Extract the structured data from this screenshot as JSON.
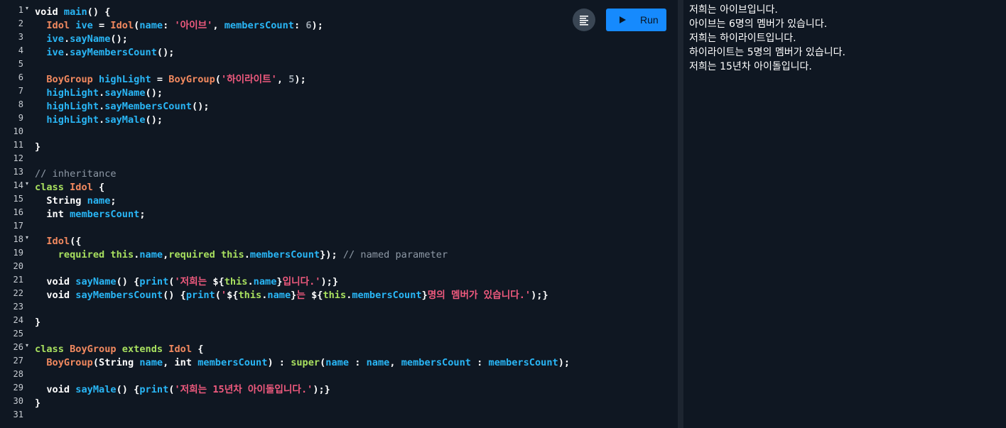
{
  "toolbar": {
    "format_icon": "format-align-icon",
    "run_icon": "play-icon",
    "run_label": "Run"
  },
  "editor": {
    "fold_glyph": "▾",
    "lines": [
      {
        "n": "1",
        "fold": true,
        "tokens": [
          [
            "kw",
            "void "
          ],
          [
            "fn",
            "main"
          ],
          [
            "pun",
            "() {"
          ]
        ]
      },
      {
        "n": "2",
        "fold": false,
        "tokens": [
          [
            "pun",
            "  "
          ],
          [
            "cls",
            "Idol "
          ],
          [
            "id",
            "ive"
          ],
          [
            "pun",
            " = "
          ],
          [
            "cls",
            "Idol"
          ],
          [
            "pun",
            "("
          ],
          [
            "id",
            "name"
          ],
          [
            "pun",
            ": "
          ],
          [
            "str",
            "'아이브'"
          ],
          [
            "pun",
            ", "
          ],
          [
            "id",
            "membersCount"
          ],
          [
            "pun",
            ": "
          ],
          [
            "num",
            "6"
          ],
          [
            "pun",
            ");"
          ]
        ]
      },
      {
        "n": "3",
        "fold": false,
        "tokens": [
          [
            "pun",
            "  "
          ],
          [
            "id",
            "ive"
          ],
          [
            "pun",
            "."
          ],
          [
            "fn",
            "sayName"
          ],
          [
            "pun",
            "();"
          ]
        ]
      },
      {
        "n": "4",
        "fold": false,
        "tokens": [
          [
            "pun",
            "  "
          ],
          [
            "id",
            "ive"
          ],
          [
            "pun",
            "."
          ],
          [
            "fn",
            "sayMembersCount"
          ],
          [
            "pun",
            "();"
          ]
        ]
      },
      {
        "n": "5",
        "fold": false,
        "tokens": []
      },
      {
        "n": "6",
        "fold": false,
        "tokens": [
          [
            "pun",
            "  "
          ],
          [
            "cls",
            "BoyGroup "
          ],
          [
            "id",
            "highLight"
          ],
          [
            "pun",
            " = "
          ],
          [
            "cls",
            "BoyGroup"
          ],
          [
            "pun",
            "("
          ],
          [
            "str",
            "'하이라이트'"
          ],
          [
            "pun",
            ", "
          ],
          [
            "num",
            "5"
          ],
          [
            "pun",
            ");"
          ]
        ]
      },
      {
        "n": "7",
        "fold": false,
        "tokens": [
          [
            "pun",
            "  "
          ],
          [
            "id",
            "highLight"
          ],
          [
            "pun",
            "."
          ],
          [
            "fn",
            "sayName"
          ],
          [
            "pun",
            "();"
          ]
        ]
      },
      {
        "n": "8",
        "fold": false,
        "tokens": [
          [
            "pun",
            "  "
          ],
          [
            "id",
            "highLight"
          ],
          [
            "pun",
            "."
          ],
          [
            "fn",
            "sayMembersCount"
          ],
          [
            "pun",
            "();"
          ]
        ]
      },
      {
        "n": "9",
        "fold": false,
        "tokens": [
          [
            "pun",
            "  "
          ],
          [
            "id",
            "highLight"
          ],
          [
            "pun",
            "."
          ],
          [
            "fn",
            "sayMale"
          ],
          [
            "pun",
            "();"
          ]
        ]
      },
      {
        "n": "10",
        "fold": false,
        "tokens": []
      },
      {
        "n": "11",
        "fold": false,
        "tokens": [
          [
            "pun",
            "}"
          ]
        ]
      },
      {
        "n": "12",
        "fold": false,
        "tokens": []
      },
      {
        "n": "13",
        "fold": false,
        "tokens": [
          [
            "cm",
            "// inheritance"
          ]
        ]
      },
      {
        "n": "14",
        "fold": true,
        "tokens": [
          [
            "grn",
            "class "
          ],
          [
            "cls",
            "Idol"
          ],
          [
            "pun",
            " {"
          ]
        ]
      },
      {
        "n": "15",
        "fold": false,
        "tokens": [
          [
            "pun",
            "  "
          ],
          [
            "kw",
            "String "
          ],
          [
            "id",
            "name"
          ],
          [
            "pun",
            ";"
          ]
        ]
      },
      {
        "n": "16",
        "fold": false,
        "tokens": [
          [
            "pun",
            "  "
          ],
          [
            "kw",
            "int "
          ],
          [
            "id",
            "membersCount"
          ],
          [
            "pun",
            ";"
          ]
        ]
      },
      {
        "n": "17",
        "fold": false,
        "tokens": []
      },
      {
        "n": "18",
        "fold": true,
        "tokens": [
          [
            "pun",
            "  "
          ],
          [
            "cls",
            "Idol"
          ],
          [
            "pun",
            "({"
          ]
        ]
      },
      {
        "n": "19",
        "fold": false,
        "tokens": [
          [
            "pun",
            "    "
          ],
          [
            "grn",
            "required this"
          ],
          [
            "pun",
            "."
          ],
          [
            "id",
            "name"
          ],
          [
            "pun",
            ","
          ],
          [
            "grn",
            "required this"
          ],
          [
            "pun",
            "."
          ],
          [
            "id",
            "membersCount"
          ],
          [
            "pun",
            "}); "
          ],
          [
            "cm",
            "// named parameter"
          ]
        ]
      },
      {
        "n": "20",
        "fold": false,
        "tokens": []
      },
      {
        "n": "21",
        "fold": false,
        "tokens": [
          [
            "pun",
            "  "
          ],
          [
            "kw",
            "void "
          ],
          [
            "fn",
            "sayName"
          ],
          [
            "pun",
            "() {"
          ],
          [
            "fn",
            "print"
          ],
          [
            "pun",
            "("
          ],
          [
            "str",
            "'저희는 "
          ],
          [
            "pun",
            "${"
          ],
          [
            "grn",
            "this"
          ],
          [
            "pun",
            "."
          ],
          [
            "id",
            "name"
          ],
          [
            "pun",
            "}"
          ],
          [
            "str",
            "입니다.'"
          ],
          [
            "pun",
            ");}"
          ]
        ]
      },
      {
        "n": "22",
        "fold": false,
        "tokens": [
          [
            "pun",
            "  "
          ],
          [
            "kw",
            "void "
          ],
          [
            "fn",
            "sayMembersCount"
          ],
          [
            "pun",
            "() {"
          ],
          [
            "fn",
            "print"
          ],
          [
            "pun",
            "("
          ],
          [
            "str",
            "'"
          ],
          [
            "pun",
            "${"
          ],
          [
            "grn",
            "this"
          ],
          [
            "pun",
            "."
          ],
          [
            "id",
            "name"
          ],
          [
            "pun",
            "}"
          ],
          [
            "str",
            "는 "
          ],
          [
            "pun",
            "${"
          ],
          [
            "grn",
            "this"
          ],
          [
            "pun",
            "."
          ],
          [
            "id",
            "membersCount"
          ],
          [
            "pun",
            "}"
          ],
          [
            "str",
            "명의 멤버가 있습니다.'"
          ],
          [
            "pun",
            ");}"
          ]
        ]
      },
      {
        "n": "23",
        "fold": false,
        "tokens": []
      },
      {
        "n": "24",
        "fold": false,
        "tokens": [
          [
            "pun",
            "}"
          ]
        ]
      },
      {
        "n": "25",
        "fold": false,
        "tokens": []
      },
      {
        "n": "26",
        "fold": true,
        "tokens": [
          [
            "grn",
            "class "
          ],
          [
            "cls",
            "BoyGroup "
          ],
          [
            "grn",
            "extends "
          ],
          [
            "cls",
            "Idol"
          ],
          [
            "pun",
            " {"
          ]
        ]
      },
      {
        "n": "27",
        "fold": false,
        "tokens": [
          [
            "pun",
            "  "
          ],
          [
            "cls",
            "BoyGroup"
          ],
          [
            "pun",
            "("
          ],
          [
            "kw",
            "String "
          ],
          [
            "id",
            "name"
          ],
          [
            "pun",
            ", "
          ],
          [
            "kw",
            "int "
          ],
          [
            "id",
            "membersCount"
          ],
          [
            "pun",
            ") : "
          ],
          [
            "grn",
            "super"
          ],
          [
            "pun",
            "("
          ],
          [
            "id",
            "name"
          ],
          [
            "pun",
            " : "
          ],
          [
            "id",
            "name"
          ],
          [
            "pun",
            ", "
          ],
          [
            "id",
            "membersCount"
          ],
          [
            "pun",
            " : "
          ],
          [
            "id",
            "membersCount"
          ],
          [
            "pun",
            ");"
          ]
        ]
      },
      {
        "n": "28",
        "fold": false,
        "tokens": []
      },
      {
        "n": "29",
        "fold": false,
        "tokens": [
          [
            "pun",
            "  "
          ],
          [
            "kw",
            "void "
          ],
          [
            "fn",
            "sayMale"
          ],
          [
            "pun",
            "() {"
          ],
          [
            "fn",
            "print"
          ],
          [
            "pun",
            "("
          ],
          [
            "str",
            "'저희는 15년차 아이돌입니다.'"
          ],
          [
            "pun",
            ");}"
          ]
        ]
      },
      {
        "n": "30",
        "fold": false,
        "tokens": [
          [
            "pun",
            "}"
          ]
        ]
      },
      {
        "n": "31",
        "fold": false,
        "tokens": []
      }
    ]
  },
  "output": {
    "lines": [
      "저희는 아이브입니다.",
      "아이브는 6명의 멤버가 있습니다.",
      "저희는 하이라이트입니다.",
      "하이라이트는 5명의 멤버가 있습니다.",
      "저희는 15년차 아이돌입니다."
    ]
  },
  "colors": {
    "background": "#0f1722",
    "run_button": "#168afd",
    "keyword_class": "#f2895f",
    "identifier": "#29b6f6",
    "string": "#f05a7e",
    "keyword_green": "#a8e05f",
    "comment": "#8e99a6"
  }
}
